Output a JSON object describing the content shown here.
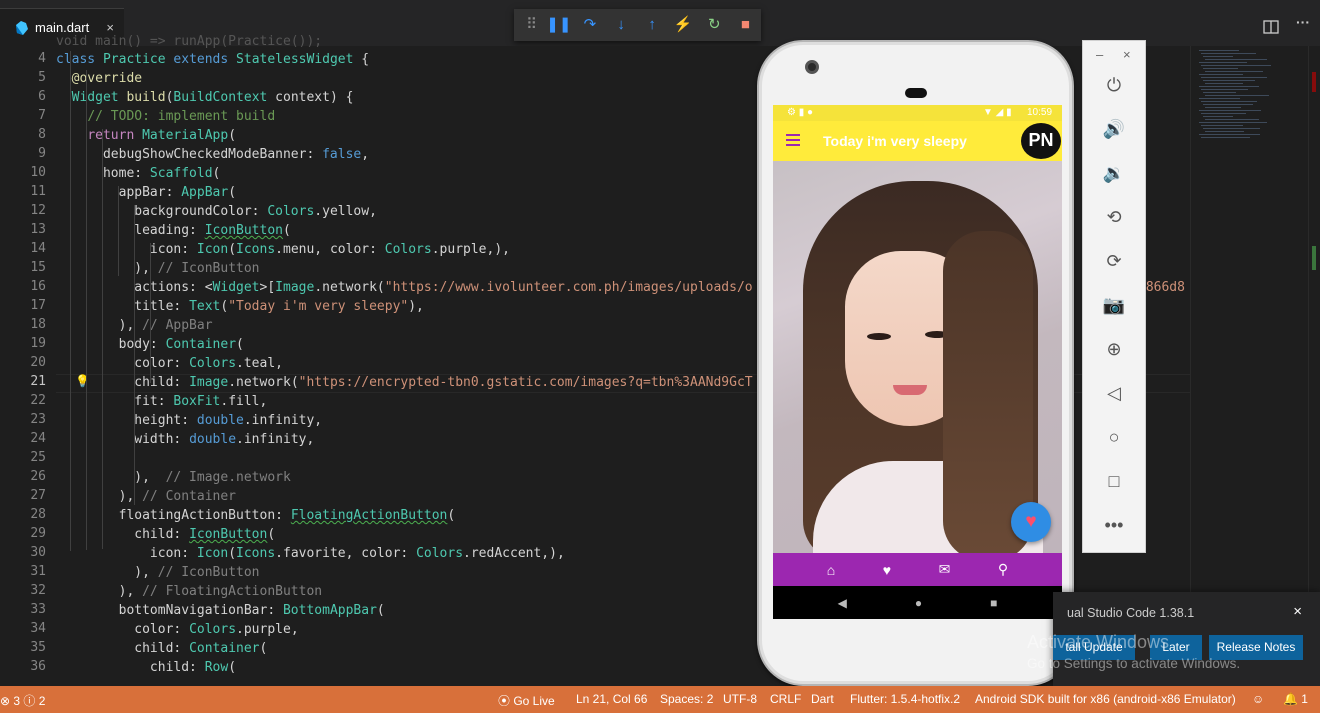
{
  "window": {
    "tab_label": "main.dart",
    "tab_close": "×",
    "split_icon": "split-editor-icon",
    "more_icon": "more-actions-icon",
    "more_label": "···"
  },
  "debug_toolbar": {
    "grip": "⠿",
    "buttons": [
      {
        "name": "pause",
        "glyph": "❚❚",
        "color": "#3794ff"
      },
      {
        "name": "step-over",
        "glyph": "↷",
        "color": "#3794ff"
      },
      {
        "name": "step-into",
        "glyph": "↓",
        "color": "#3794ff"
      },
      {
        "name": "step-out",
        "glyph": "↑",
        "color": "#3794ff"
      },
      {
        "name": "hot-reload",
        "glyph": "⚡",
        "color": "#f9a825"
      },
      {
        "name": "restart",
        "glyph": "↻",
        "color": "#89d185"
      },
      {
        "name": "stop",
        "glyph": "■",
        "color": "#f48771"
      }
    ]
  },
  "editor": {
    "current_line": "21",
    "lines": [
      {
        "n": "4"
      },
      {
        "n": "5"
      },
      {
        "n": "6"
      },
      {
        "n": "7"
      },
      {
        "n": "8"
      },
      {
        "n": "9"
      },
      {
        "n": "10"
      },
      {
        "n": "11"
      },
      {
        "n": "12"
      },
      {
        "n": "13"
      },
      {
        "n": "14"
      },
      {
        "n": "15"
      },
      {
        "n": "16"
      },
      {
        "n": "17"
      },
      {
        "n": "18"
      },
      {
        "n": "19"
      },
      {
        "n": "20"
      },
      {
        "n": "21"
      },
      {
        "n": "22"
      },
      {
        "n": "23"
      },
      {
        "n": "24"
      },
      {
        "n": "25"
      },
      {
        "n": "26"
      },
      {
        "n": "27"
      },
      {
        "n": "28"
      },
      {
        "n": "29"
      },
      {
        "n": "30"
      },
      {
        "n": "31"
      },
      {
        "n": "32"
      },
      {
        "n": "33"
      },
      {
        "n": "34"
      },
      {
        "n": "35"
      },
      {
        "n": "36"
      }
    ],
    "code": [
      [
        [
          "k",
          "class "
        ],
        [
          "t",
          "Practice "
        ],
        [
          "k",
          "extends "
        ],
        [
          "t",
          "StatelessWidget "
        ],
        [
          "p",
          "{"
        ]
      ],
      [
        [
          "p",
          "  "
        ],
        [
          "a",
          "@override"
        ]
      ],
      [
        [
          "p",
          "  "
        ],
        [
          "t",
          "Widget "
        ],
        [
          "f",
          "build"
        ],
        [
          "p",
          "("
        ],
        [
          "t",
          "BuildContext "
        ],
        [
          "p",
          "context) {"
        ]
      ],
      [
        [
          "p",
          "    "
        ],
        [
          "cm",
          "// TODO: implement build"
        ]
      ],
      [
        [
          "p",
          "    "
        ],
        [
          "c",
          "return "
        ],
        [
          "t",
          "MaterialApp"
        ],
        [
          "p",
          "("
        ]
      ],
      [
        [
          "p",
          "      debugShowCheckedModeBanner: "
        ],
        [
          "k",
          "false"
        ],
        [
          "p",
          ","
        ]
      ],
      [
        [
          "p",
          "      home: "
        ],
        [
          "t",
          "Scaffold"
        ],
        [
          "p",
          "("
        ]
      ],
      [
        [
          "p",
          "        appBar: "
        ],
        [
          "t",
          "AppBar"
        ],
        [
          "p",
          "("
        ]
      ],
      [
        [
          "p",
          "          backgroundColor: "
        ],
        [
          "t",
          "Colors"
        ],
        [
          "p",
          ".yellow,"
        ]
      ],
      [
        [
          "p",
          "          leading: "
        ],
        [
          "tu",
          "IconButton"
        ],
        [
          "p",
          "("
        ]
      ],
      [
        [
          "p",
          "            icon: "
        ],
        [
          "t",
          "Icon"
        ],
        [
          "p",
          "("
        ],
        [
          "t",
          "Icons"
        ],
        [
          "p",
          ".menu, color: "
        ],
        [
          "t",
          "Colors"
        ],
        [
          "p",
          ".purple,),"
        ]
      ],
      [
        [
          "p",
          "          ), "
        ],
        [
          "g",
          "// IconButton"
        ]
      ],
      [
        [
          "p",
          "          actions: <"
        ],
        [
          "t",
          "Widget"
        ],
        [
          "p",
          ">["
        ],
        [
          "t",
          "Image"
        ],
        [
          "p",
          ".network("
        ],
        [
          "s",
          "\"https://www.ivolunteer.com.ph/images/uploads/o"
        ]
      ],
      [
        [
          "p",
          "          title: "
        ],
        [
          "t",
          "Text"
        ],
        [
          "p",
          "("
        ],
        [
          "s",
          "\"Today i'm very sleepy\""
        ],
        [
          "p",
          "),"
        ]
      ],
      [
        [
          "p",
          "        ), "
        ],
        [
          "g",
          "// AppBar"
        ]
      ],
      [
        [
          "p",
          "        body: "
        ],
        [
          "t",
          "Container"
        ],
        [
          "p",
          "("
        ]
      ],
      [
        [
          "p",
          "          color: "
        ],
        [
          "t",
          "Colors"
        ],
        [
          "p",
          ".teal,"
        ]
      ],
      [
        [
          "p",
          "          child: "
        ],
        [
          "t",
          "Image"
        ],
        [
          "p",
          ".network("
        ],
        [
          "s",
          "\"https://encrypted-tbn0.gstatic.com/images?q=tbn%3AANd9GcT"
        ]
      ],
      [
        [
          "p",
          "          fit: "
        ],
        [
          "t",
          "BoxFit"
        ],
        [
          "p",
          ".fill,"
        ]
      ],
      [
        [
          "p",
          "          height: "
        ],
        [
          "k",
          "double"
        ],
        [
          "p",
          ".infinity,"
        ]
      ],
      [
        [
          "p",
          "          width: "
        ],
        [
          "k",
          "double"
        ],
        [
          "p",
          ".infinity,"
        ]
      ],
      [
        [
          "p",
          ""
        ]
      ],
      [
        [
          "p",
          "          ),  "
        ],
        [
          "g",
          "// Image.network"
        ]
      ],
      [
        [
          "p",
          "        ), "
        ],
        [
          "g",
          "// Container"
        ]
      ],
      [
        [
          "p",
          "        floatingActionButton: "
        ],
        [
          "tu",
          "FloatingActionButton"
        ],
        [
          "p",
          "("
        ]
      ],
      [
        [
          "p",
          "          child: "
        ],
        [
          "tu",
          "IconButton"
        ],
        [
          "p",
          "("
        ]
      ],
      [
        [
          "p",
          "            icon: "
        ],
        [
          "t",
          "Icon"
        ],
        [
          "p",
          "("
        ],
        [
          "t",
          "Icons"
        ],
        [
          "p",
          ".favorite, color: "
        ],
        [
          "t",
          "Colors"
        ],
        [
          "p",
          ".redAccent,),"
        ]
      ],
      [
        [
          "p",
          "          ), "
        ],
        [
          "g",
          "// IconButton"
        ]
      ],
      [
        [
          "p",
          "        ), "
        ],
        [
          "g",
          "// FloatingActionButton"
        ]
      ],
      [
        [
          "p",
          "        bottomNavigationBar: "
        ],
        [
          "t",
          "BottomAppBar"
        ],
        [
          "p",
          "("
        ]
      ],
      [
        [
          "p",
          "          color: "
        ],
        [
          "t",
          "Colors"
        ],
        [
          "p",
          ".purple,"
        ]
      ],
      [
        [
          "p",
          "          child: "
        ],
        [
          "t",
          "Container"
        ],
        [
          "p",
          "("
        ]
      ],
      [
        [
          "p",
          "            child: "
        ],
        [
          "t",
          "Row"
        ],
        [
          "p",
          "("
        ]
      ]
    ],
    "partial_top": "void main() => runApp(Practice());",
    "overflow_16": "6866d8"
  },
  "phone": {
    "status_time": "10:59",
    "app_title": "Today i'm very sleepy",
    "logo_text": "PN",
    "fab_icon": "favorite-icon",
    "fab_glyph": "♥",
    "nav_icons": [
      {
        "name": "home-icon",
        "glyph": "⌂"
      },
      {
        "name": "favorite-icon",
        "glyph": "♥"
      },
      {
        "name": "message-icon",
        "glyph": "✉"
      },
      {
        "name": "search-icon",
        "glyph": "⚲"
      }
    ],
    "sys_nav": [
      {
        "name": "back-icon",
        "glyph": "◀"
      },
      {
        "name": "home-circle-icon",
        "glyph": "●"
      },
      {
        "name": "recents-icon",
        "glyph": "■"
      }
    ]
  },
  "emulator_panel": {
    "minimize": "–",
    "close": "×",
    "buttons": [
      {
        "name": "power-icon",
        "glyph": "⏻"
      },
      {
        "name": "volume-up-icon",
        "glyph": "🔊"
      },
      {
        "name": "volume-down-icon",
        "glyph": "🔉"
      },
      {
        "name": "rotate-left-icon",
        "glyph": "⟲"
      },
      {
        "name": "rotate-right-icon",
        "glyph": "⟳"
      },
      {
        "name": "camera-icon",
        "glyph": "📷"
      },
      {
        "name": "zoom-icon",
        "glyph": "⊕"
      },
      {
        "name": "back-icon",
        "glyph": "◁"
      },
      {
        "name": "home-icon",
        "glyph": "○"
      },
      {
        "name": "overview-icon",
        "glyph": "□"
      },
      {
        "name": "more-icon",
        "glyph": "•••"
      }
    ]
  },
  "notification": {
    "message": "ual Studio Code 1.38.1",
    "install_label": "tall Update",
    "later_label": "Later",
    "release_notes_label": "Release Notes",
    "close": "×"
  },
  "watermark": {
    "line1": "Activate Windows",
    "line2": "Go to Settings to activate Windows."
  },
  "status_bar": {
    "problems": "3",
    "warnings": "2",
    "go_live": "Go Live",
    "position": "Ln 21, Col 66",
    "spaces": "Spaces: 2",
    "encoding": "UTF-8",
    "eol": "CRLF",
    "language": "Dart",
    "flutter": "Flutter: 1.5.4-hotfix.2",
    "device": "Android SDK built for x86 (android-x86 Emulator)",
    "bell_count": "1"
  }
}
